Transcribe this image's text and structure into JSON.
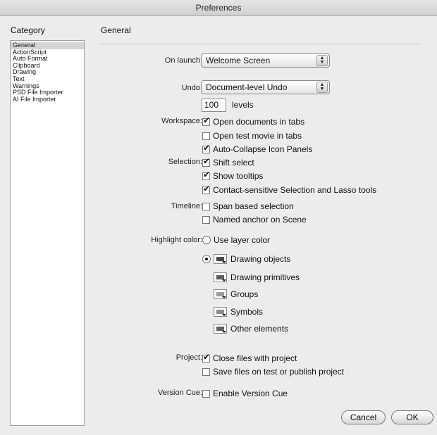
{
  "window": {
    "title": "Preferences"
  },
  "sidebar": {
    "heading": "Category",
    "items": [
      {
        "label": "General",
        "selected": true
      },
      {
        "label": "ActionScript"
      },
      {
        "label": "Auto Format"
      },
      {
        "label": "Clipboard"
      },
      {
        "label": "Drawing"
      },
      {
        "label": "Text"
      },
      {
        "label": "Warnings"
      },
      {
        "label": "PSD File Importer"
      },
      {
        "label": "AI File Importer"
      }
    ]
  },
  "main": {
    "heading": "General",
    "on_launch": {
      "label": "On launch:",
      "value": "Welcome Screen"
    },
    "undo": {
      "label": "Undo:",
      "value": "Document-level Undo",
      "levels_value": "100",
      "levels_label": "levels"
    },
    "workspace": {
      "label": "Workspace:",
      "options": [
        {
          "label": "Open documents in tabs",
          "checked": true
        },
        {
          "label": "Open test movie in tabs",
          "checked": false
        },
        {
          "label": "Auto-Collapse Icon Panels",
          "checked": true
        }
      ]
    },
    "selection": {
      "label": "Selection:",
      "options": [
        {
          "label": "Shift select",
          "checked": true
        },
        {
          "label": "Show tooltips",
          "checked": true
        },
        {
          "label": "Contact-sensitive Selection and Lasso tools",
          "checked": true
        }
      ]
    },
    "timeline": {
      "label": "Timeline:",
      "options": [
        {
          "label": "Span based selection",
          "checked": false
        },
        {
          "label": "Named anchor on Scene",
          "checked": false
        }
      ]
    },
    "highlight": {
      "label": "Highlight color:",
      "use_layer_color": "Use layer color",
      "items": [
        {
          "label": "Drawing objects",
          "color": "#4a4a4a"
        },
        {
          "label": "Drawing primitives",
          "color": "#5a5a5a"
        },
        {
          "label": "Groups",
          "color": "#9a9a9a"
        },
        {
          "label": "Symbols",
          "color": "#8a8a8a"
        },
        {
          "label": "Other elements",
          "color": "#5f5f5f"
        }
      ]
    },
    "project": {
      "label": "Project:",
      "options": [
        {
          "label": "Close files with project",
          "checked": true
        },
        {
          "label": "Save files on test or publish project",
          "checked": false
        }
      ]
    },
    "version_cue": {
      "label": "Version Cue:",
      "option": "Enable Version Cue"
    }
  },
  "buttons": {
    "cancel": "Cancel",
    "ok": "OK"
  }
}
